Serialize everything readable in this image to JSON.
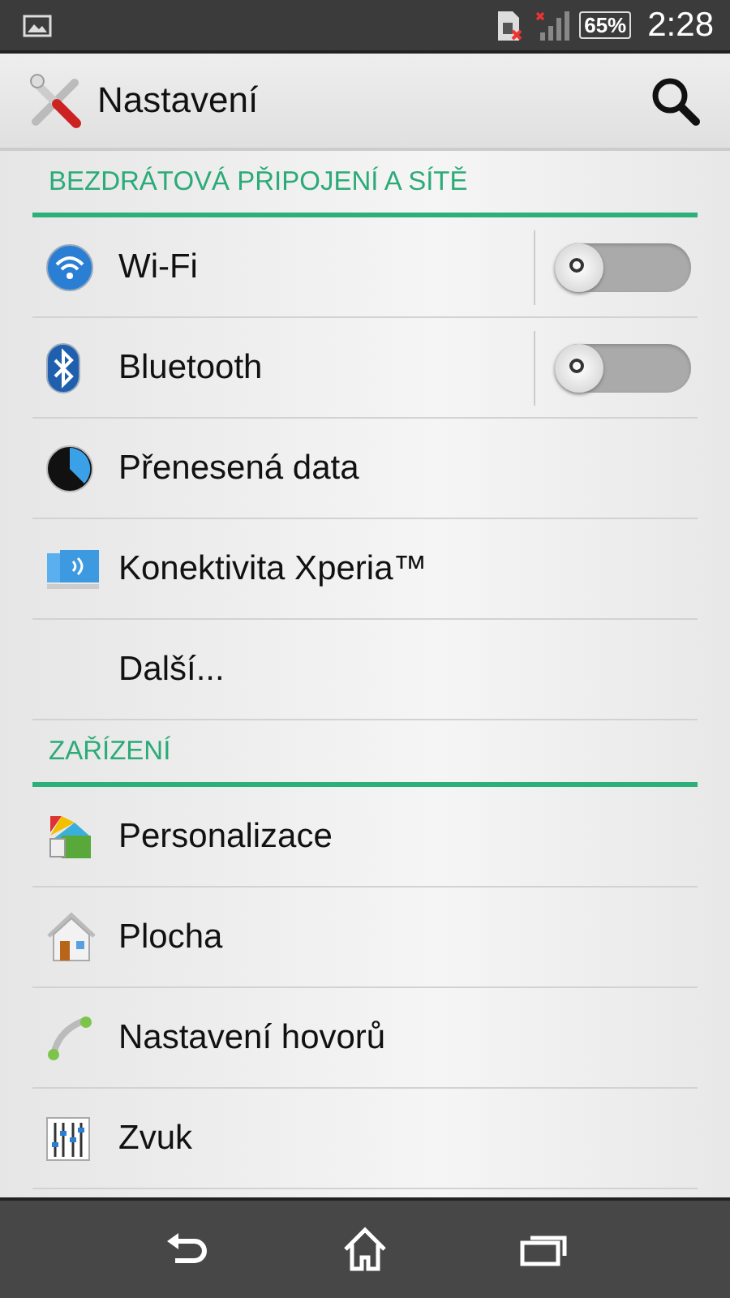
{
  "status_bar": {
    "battery": "65%",
    "time": "2:28"
  },
  "action_bar": {
    "title": "Nastavení"
  },
  "sections": [
    {
      "title": "BEZDRÁTOVÁ PŘIPOJENÍ A SÍTĚ",
      "items": [
        {
          "label": "Wi-Fi",
          "kind": "switch",
          "on": false
        },
        {
          "label": "Bluetooth",
          "kind": "switch",
          "on": false
        },
        {
          "label": "Přenesená data",
          "kind": "plain"
        },
        {
          "label": "Konektivita Xperia™",
          "kind": "plain"
        },
        {
          "label": "Další...",
          "kind": "plain"
        }
      ]
    },
    {
      "title": "ZAŘÍZENÍ",
      "items": [
        {
          "label": "Personalizace",
          "kind": "plain"
        },
        {
          "label": "Plocha",
          "kind": "plain"
        },
        {
          "label": "Nastavení hovorů",
          "kind": "plain"
        },
        {
          "label": "Zvuk",
          "kind": "plain"
        }
      ]
    }
  ]
}
